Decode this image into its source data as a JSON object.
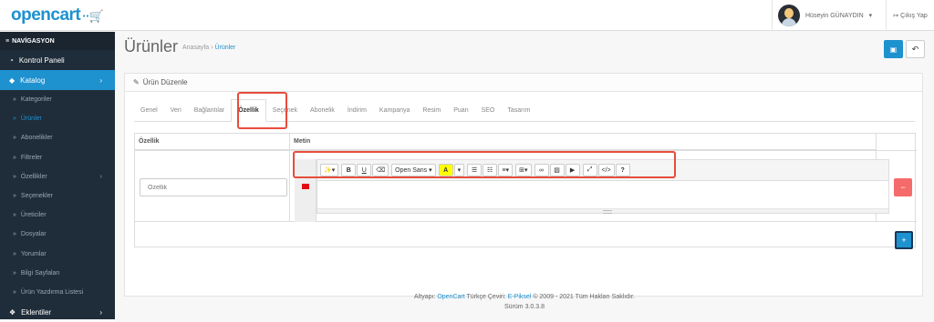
{
  "header": {
    "logo": "opencart",
    "logo_cart": "··🛒",
    "user_name": "Hüseyin GÜNAYDIN",
    "user_caret": "▾",
    "logout_icon": "↦",
    "logout_label": "Çıkış Yap"
  },
  "sidebar": {
    "nav_icon": "≡",
    "nav_label": "NAVİGASYON",
    "dashboard_icon": "◔",
    "dashboard_label": "Kontrol Paneli",
    "catalog_icon": "◆",
    "catalog_label": "Katalog",
    "catalog_caret": "›",
    "sub_arrow": "»",
    "items": [
      {
        "label": "Kategoriler",
        "caret": ""
      },
      {
        "label": "Ürünler",
        "caret": ""
      },
      {
        "label": "Abonelikler",
        "caret": ""
      },
      {
        "label": "Filtreler",
        "caret": ""
      },
      {
        "label": "Özellikler",
        "caret": "›"
      },
      {
        "label": "Seçenekler",
        "caret": ""
      },
      {
        "label": "Üreticiler",
        "caret": ""
      },
      {
        "label": "Dosyalar",
        "caret": ""
      },
      {
        "label": "Yorumlar",
        "caret": ""
      },
      {
        "label": "Bilgi Sayfaları",
        "caret": ""
      },
      {
        "label": "Ürün Yazdırma Listesi",
        "caret": ""
      }
    ],
    "extensions_icon": "❖",
    "extensions_label": "Eklentiler",
    "extensions_caret": "›"
  },
  "page": {
    "title": "Ürünler",
    "breadcrumb_home": "Anasayfa",
    "breadcrumb_sep": "›",
    "breadcrumb_current": "Ürünler",
    "save_icon": "▣",
    "back_icon": "↶"
  },
  "panel": {
    "edit_icon": "✎",
    "title": "Ürün Düzenle",
    "tabs": [
      "Genel",
      "Veri",
      "Bağlantılar",
      "Özellik",
      "Seçenek",
      "Abonelik",
      "İndirim",
      "Kampanya",
      "Resim",
      "Puan",
      "SEO",
      "Tasarım"
    ],
    "active_tab": "Özellik"
  },
  "table": {
    "col_feature": "Özellik",
    "col_text": "Metin",
    "feature_placeholder": "Özellik",
    "remove_icon": "−",
    "add_icon": "+"
  },
  "editor": {
    "font_name": "Open Sans",
    "caret": "▾",
    "wand": "✨",
    "bold": "B",
    "underline": "U",
    "eraser": "⌫",
    "color_a": "A",
    "ul": "☰",
    "ol": "☷",
    "para": "≡",
    "table": "⊞",
    "link": "∞",
    "picture": "▨",
    "video": "▶",
    "fullscreen": "⤢",
    "code": "</>",
    "help": "?"
  },
  "footer": {
    "line1_prefix": "Altyapı:",
    "opencart": "OpenCart",
    "middle": "Türkçe Çeviri:",
    "epiksel": "E-Piksel",
    "suffix": "© 2009 - 2021 Tüm Hakları Saklıdır.",
    "version": "Sürüm 3.0.3.8"
  },
  "colors": {
    "accent": "#1e91cf",
    "sidebar": "#1f2d3a",
    "danger": "#f56b6b",
    "highlight": "#e74c3c"
  }
}
